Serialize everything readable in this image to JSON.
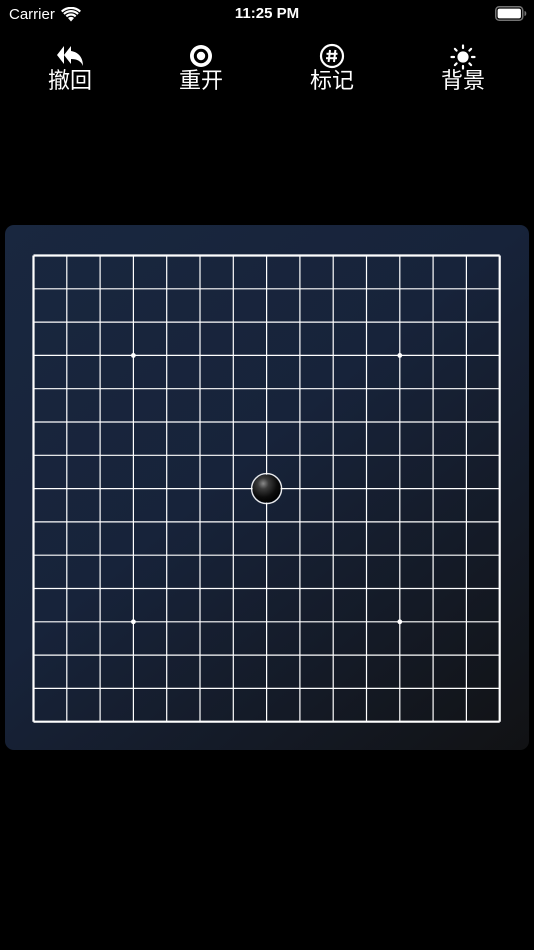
{
  "status_bar": {
    "carrier": "Carrier",
    "time": "11:25 PM",
    "wifi_icon": "wifi-icon",
    "battery_icon": "battery-full-icon"
  },
  "toolbar": {
    "undo": {
      "label": "撤回",
      "icon": "undo-icon"
    },
    "restart": {
      "label": "重开",
      "icon": "restart-icon"
    },
    "mark": {
      "label": "标记",
      "icon": "hash-mark-icon"
    },
    "background": {
      "label": "背景",
      "icon": "sun-icon"
    }
  },
  "board": {
    "lines": 15,
    "star_points": [
      [
        3,
        3
      ],
      [
        11,
        3
      ],
      [
        3,
        11
      ],
      [
        11,
        11
      ]
    ],
    "stones": [
      {
        "col": 7,
        "row": 7,
        "color": "black"
      }
    ],
    "line_color": "#ffffff"
  }
}
